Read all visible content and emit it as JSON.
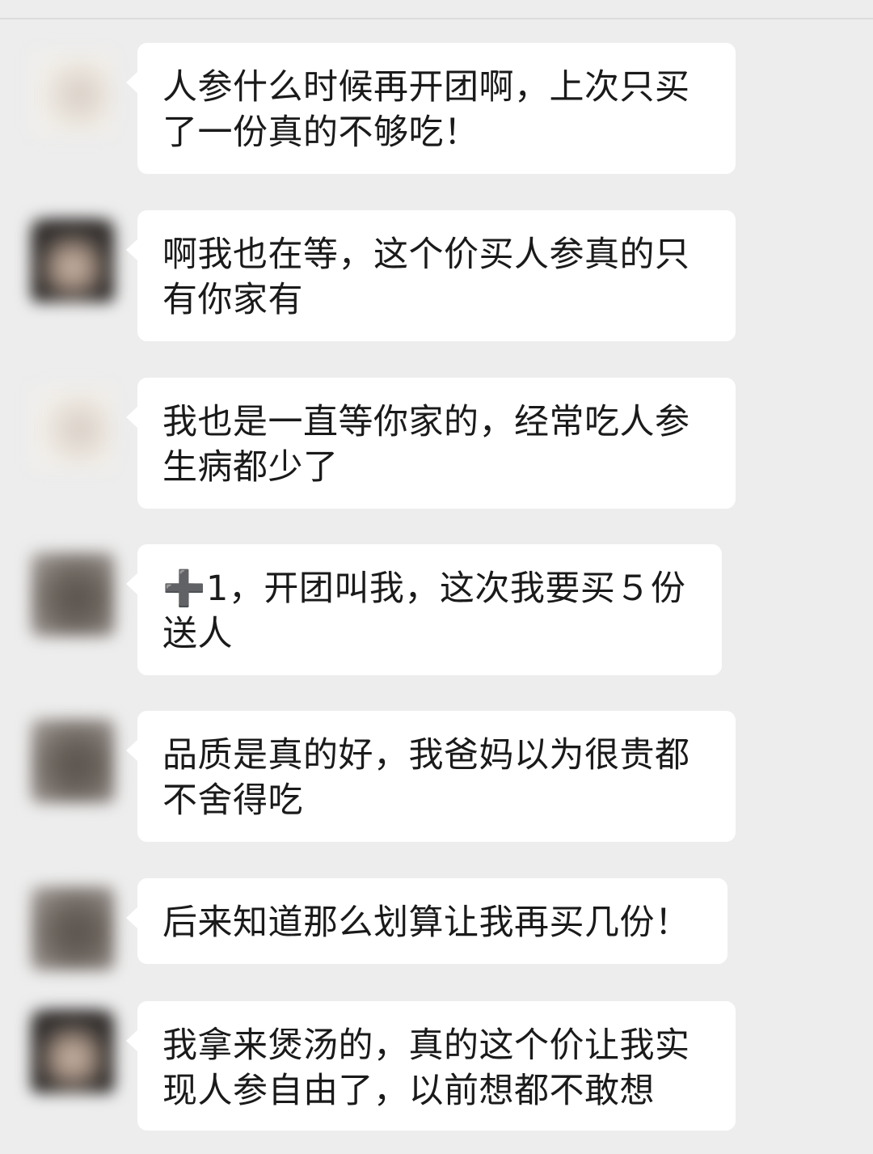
{
  "messages": [
    {
      "text": "人参什么时候再开团啊，上次只买了一份真的不够吃！",
      "avatar": "light"
    },
    {
      "text": "啊我也在等，这个价买人参真的只有你家有",
      "avatar": "face"
    },
    {
      "text": "我也是一直等你家的，经常吃人参生病都少了",
      "avatar": "light"
    },
    {
      "text": "➕1，开团叫我，这次我要买５份送人",
      "avatar": "dark"
    },
    {
      "text": "品质是真的好，我爸妈以为很贵都不舍得吃",
      "avatar": "dark"
    },
    {
      "text": "后来知道那么划算让我再买几份！",
      "avatar": "dark"
    },
    {
      "text": "我拿来煲汤的，真的这个价让我实现人参自由了，以前想都不敢想",
      "avatar": "face"
    }
  ],
  "colors": {
    "background": "#ededed",
    "bubble": "#ffffff",
    "text": "#1a1a1a"
  }
}
